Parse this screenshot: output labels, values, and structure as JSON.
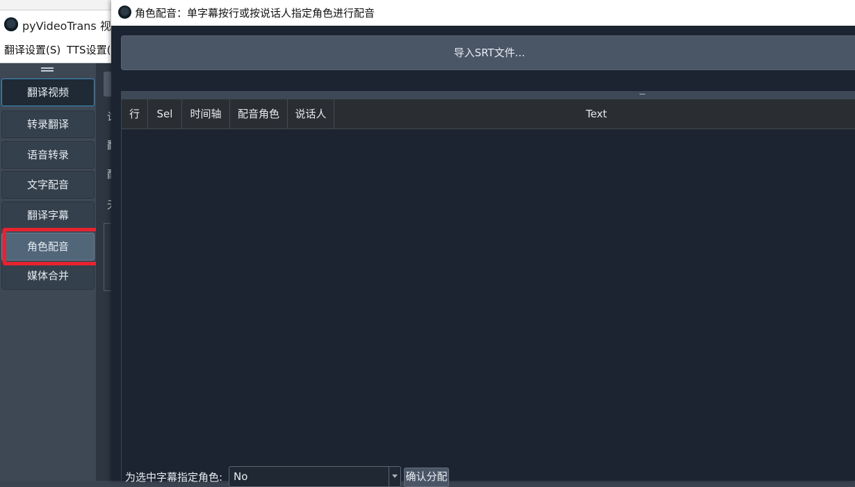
{
  "bg_app": {
    "title": "pyVideoTrans 视频",
    "menu": [
      "翻译设置(S)",
      "TTS设置(I"
    ],
    "sidebar": [
      "翻译视频",
      "转录翻译",
      "语音转录",
      "文字配音",
      "翻译字幕",
      "角色配音",
      "媒体合并"
    ],
    "mid_chars": [
      "试",
      "翻",
      "配",
      "无"
    ]
  },
  "dialog": {
    "title": "角色配音：单字幕按行或按说话人指定角色进行配音",
    "import_button": "导入SRT文件...",
    "table": {
      "headers": [
        "行",
        "Sel",
        "时间轴",
        "配音角色",
        "说话人",
        "Text"
      ],
      "rows": []
    },
    "assign_label": "为选中字幕指定角色:",
    "role_select_value": "No",
    "confirm_button": "确认分配"
  },
  "colors": {
    "highlight": "#e8232f",
    "dialog_bg": "#1b2430",
    "sidebar_bg": "#3e4855"
  }
}
